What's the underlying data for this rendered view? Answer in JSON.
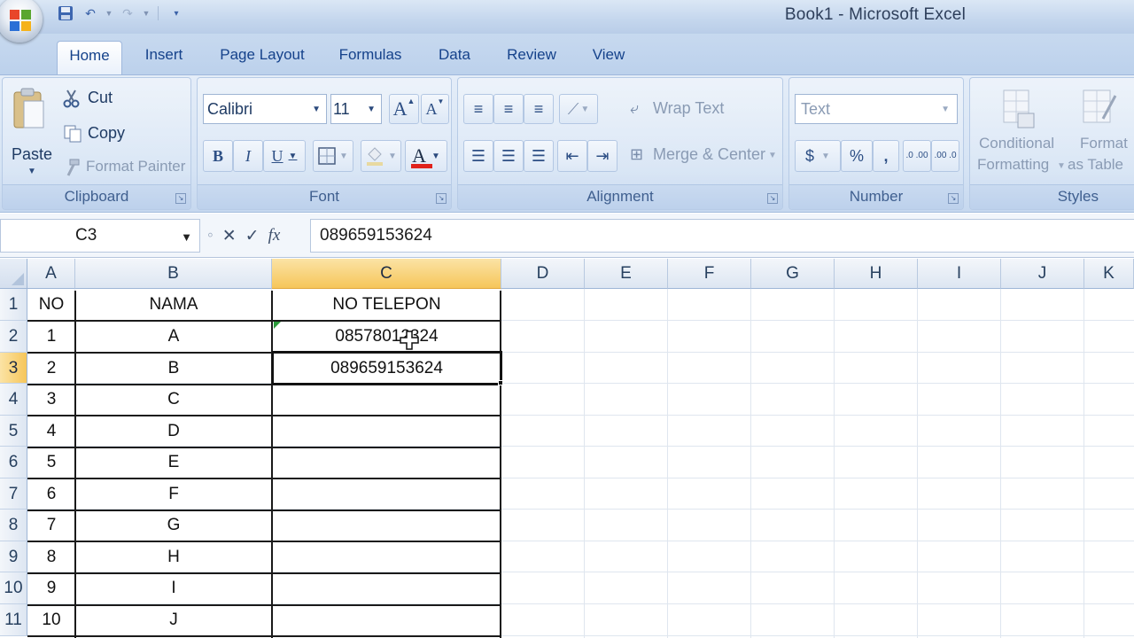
{
  "window": {
    "title": "Book1 - Microsoft Excel"
  },
  "tabs": [
    "Home",
    "Insert",
    "Page Layout",
    "Formulas",
    "Data",
    "Review",
    "View"
  ],
  "ribbon": {
    "clipboard": {
      "label": "Clipboard",
      "paste": "Paste",
      "cut": "Cut",
      "copy": "Copy",
      "format_painter": "Format Painter"
    },
    "font": {
      "label": "Font",
      "family": "Calibri",
      "size": "11",
      "bold": "B",
      "italic": "I",
      "underline": "U",
      "grow": "A",
      "shrink": "A",
      "color_letter": "A"
    },
    "alignment": {
      "label": "Alignment",
      "wrap_text": "Wrap Text",
      "merge_center": "Merge & Center"
    },
    "number": {
      "label": "Number",
      "format": "Text",
      "currency": "$",
      "percent": "%",
      "comma": ",",
      "inc_decimal": ".0 .00",
      "dec_decimal": ".00 .0"
    },
    "styles": {
      "label": "Styles",
      "conditional_1": "Conditional",
      "conditional_2": "Formatting",
      "format_table_1": "Format",
      "format_table_2": "as Table"
    }
  },
  "formula_bar": {
    "name_box": "C3",
    "fx": "fx",
    "value": "089659153624"
  },
  "sheet": {
    "columns": [
      "A",
      "B",
      "C",
      "D",
      "E",
      "F",
      "G",
      "H",
      "I",
      "J",
      "K"
    ],
    "selected_column": "C",
    "selected_row": 3,
    "header": [
      "NO",
      "NAMA",
      "NO TELEPON"
    ],
    "rows": [
      {
        "no": "1",
        "nama": "A",
        "telp": "08578012324"
      },
      {
        "no": "2",
        "nama": "B",
        "telp": "089659153624"
      },
      {
        "no": "3",
        "nama": "C",
        "telp": ""
      },
      {
        "no": "4",
        "nama": "D",
        "telp": ""
      },
      {
        "no": "5",
        "nama": "E",
        "telp": ""
      },
      {
        "no": "6",
        "nama": "F",
        "telp": ""
      },
      {
        "no": "7",
        "nama": "G",
        "telp": ""
      },
      {
        "no": "8",
        "nama": "H",
        "telp": ""
      },
      {
        "no": "9",
        "nama": "I",
        "telp": ""
      },
      {
        "no": "10",
        "nama": "J",
        "telp": ""
      }
    ]
  },
  "colors": {
    "selected_header": "#f6c65a",
    "accent": "#15428b",
    "font_color_bar": "#e0221b"
  }
}
